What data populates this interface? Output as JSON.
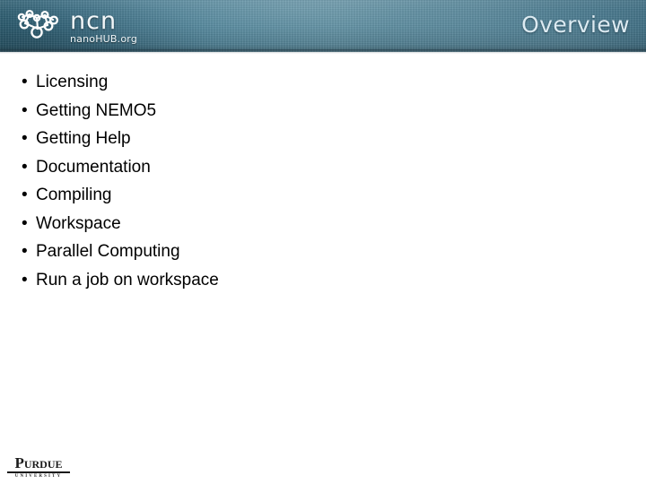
{
  "header": {
    "title": "Overview",
    "logo": {
      "mark_name": "ncn-network-icon",
      "wordmark": "ncn",
      "subtext": "nanoHUB.org"
    },
    "colors": {
      "banner_left": "#2e6277",
      "banner_mid": "#55899d",
      "banner_right": "#386a80",
      "title_text": "#dceaf1"
    }
  },
  "main": {
    "bullet_char": "•",
    "items": [
      {
        "label": "Licensing"
      },
      {
        "label": "Getting NEMO5"
      },
      {
        "label": "Getting Help"
      },
      {
        "label": "Documentation"
      },
      {
        "label": "Compiling"
      },
      {
        "label": "Workspace"
      },
      {
        "label": "Parallel Computing"
      },
      {
        "label": "Run a job on workspace"
      }
    ]
  },
  "footer": {
    "purdue": {
      "name": "Purdue",
      "sub": "UNIVERSITY"
    }
  }
}
